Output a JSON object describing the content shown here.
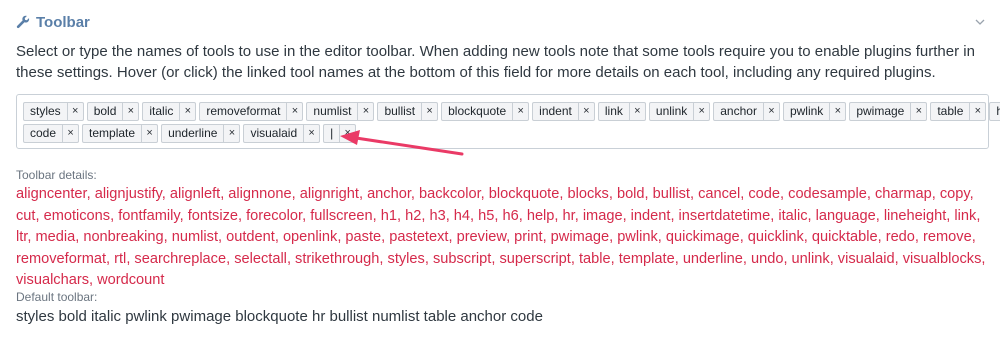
{
  "panel": {
    "title": "Toolbar",
    "description": "Select or type the names of tools to use in the editor toolbar. When adding new tools note that some tools require you to enable plugins further in these settings. Hover (or click) the linked tool names at the bottom of this field for more details on each tool, including any required plugins."
  },
  "toolbar_tokens": {
    "remove_symbol": "×",
    "line1": [
      "styles",
      "bold",
      "italic",
      "removeformat",
      "numlist",
      "bullist",
      "blockquote",
      "indent",
      "link",
      "unlink",
      "anchor",
      "pwlink",
      "pwimage",
      "table",
      "hr"
    ],
    "line2": [
      "code",
      "template",
      "underline",
      "visualaid",
      "|"
    ]
  },
  "details": {
    "heading": "Toolbar details:",
    "tools": [
      "aligncenter",
      "alignjustify",
      "alignleft",
      "alignnone",
      "alignright",
      "anchor",
      "backcolor",
      "blockquote",
      "blocks",
      "bold",
      "bullist",
      "cancel",
      "code",
      "codesample",
      "charmap",
      "copy",
      "cut",
      "emoticons",
      "fontfamily",
      "fontsize",
      "forecolor",
      "fullscreen",
      "h1",
      "h2",
      "h3",
      "h4",
      "h5",
      "h6",
      "help",
      "hr",
      "image",
      "indent",
      "insertdatetime",
      "italic",
      "language",
      "lineheight",
      "link",
      "ltr",
      "media",
      "nonbreaking",
      "numlist",
      "outdent",
      "openlink",
      "paste",
      "pastetext",
      "preview",
      "print",
      "pwimage",
      "pwlink",
      "quickimage",
      "quicklink",
      "quicktable",
      "redo",
      "remove",
      "removeformat",
      "rtl",
      "searchreplace",
      "selectall",
      "strikethrough",
      "styles",
      "subscript",
      "superscript",
      "table",
      "template",
      "underline",
      "undo",
      "unlink",
      "visualaid",
      "visualblocks",
      "visualchars",
      "wordcount"
    ]
  },
  "default_toolbar": {
    "heading": "Default toolbar:",
    "value": "styles bold italic pwlink pwimage blockquote hr bullist numlist table anchor code"
  },
  "colors": {
    "title": "#5a7fa8",
    "link": "#d52a4b",
    "arrow": "#ea3a66"
  },
  "icons": {
    "header": "wrench-icon",
    "collapse": "chevron-down-icon",
    "remove": "close-icon"
  }
}
